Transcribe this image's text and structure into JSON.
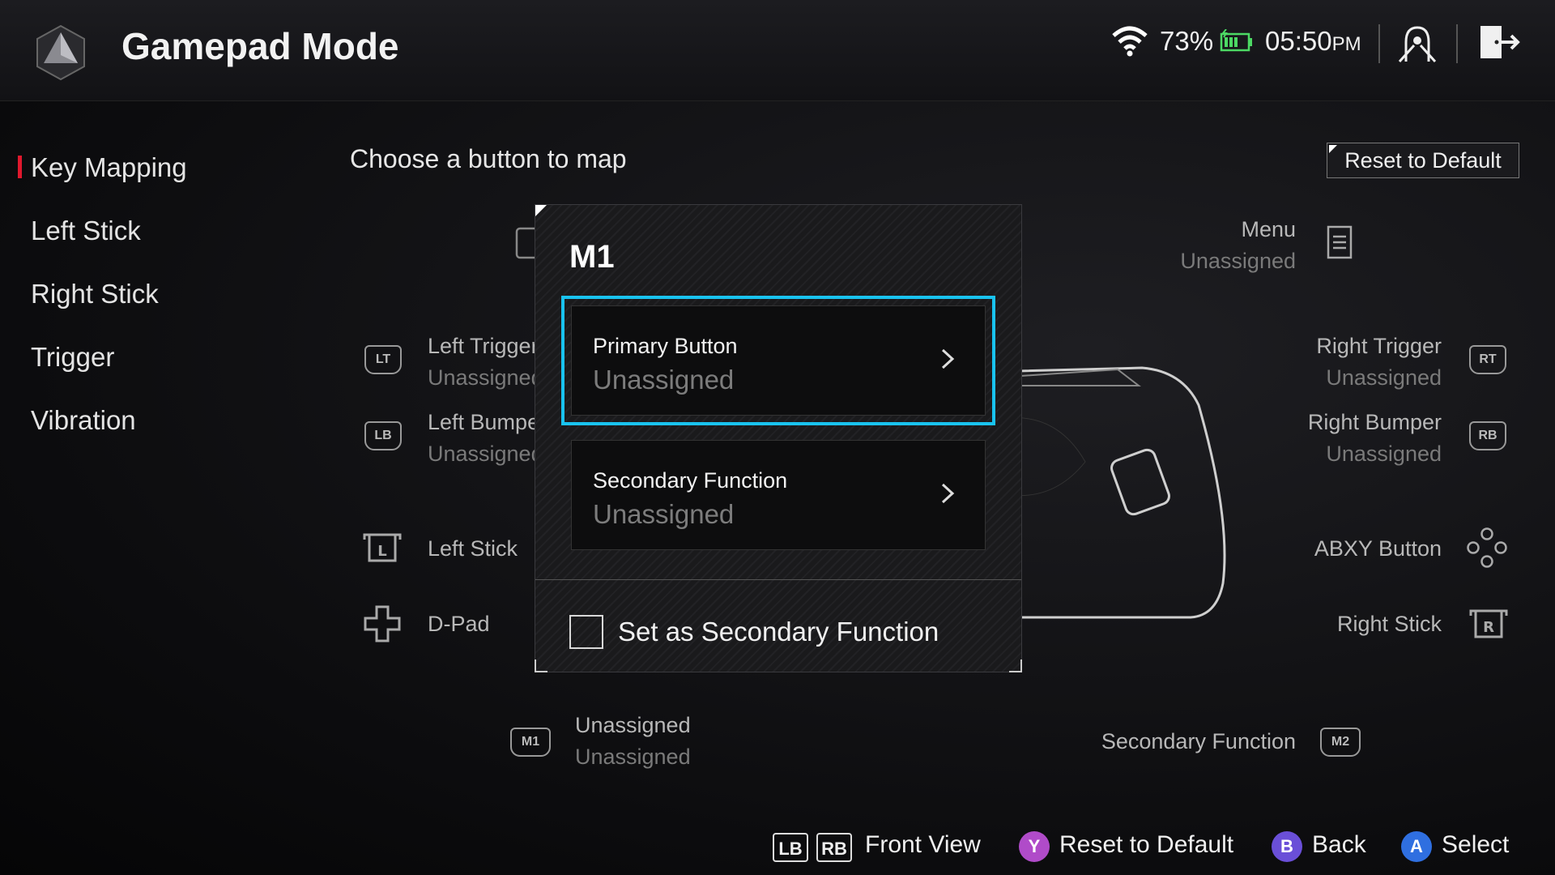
{
  "header": {
    "title": "Gamepad Mode",
    "battery_percent": "73%",
    "time": "05:50",
    "time_suffix": "PM",
    "accent_color": "#e0182d"
  },
  "sidebar": {
    "items": [
      {
        "label": "Key Mapping",
        "active": true
      },
      {
        "label": "Left Stick"
      },
      {
        "label": "Right Stick"
      },
      {
        "label": "Trigger"
      },
      {
        "label": "Vibration"
      }
    ]
  },
  "main": {
    "heading": "Choose a button to map",
    "reset_label": "Reset to Default",
    "menu": {
      "name": "Menu",
      "value": "Unassigned"
    },
    "left_trigger": {
      "badge": "LT",
      "name": "Left Trigger",
      "value": "Unassigned"
    },
    "left_bumper": {
      "badge": "LB",
      "name": "Left Bumper",
      "value": "Unassigned"
    },
    "left_stick": {
      "name": "Left Stick"
    },
    "dpad": {
      "name": "D-Pad"
    },
    "m1": {
      "badge": "M1",
      "name": "Unassigned",
      "value": "Unassigned"
    },
    "right_trigger": {
      "badge": "RT",
      "name": "Right Trigger",
      "value": "Unassigned"
    },
    "right_bumper": {
      "badge": "RB",
      "name": "Right Bumper",
      "value": "Unassigned"
    },
    "abxy": {
      "name": "ABXY Button"
    },
    "right_stick": {
      "name": "Right Stick"
    },
    "m2": {
      "badge": "M2",
      "name": "Secondary Function"
    }
  },
  "modal": {
    "title": "M1",
    "primary": {
      "label": "Primary Button",
      "value": "Unassigned"
    },
    "secondary": {
      "label": "Secondary Function",
      "value": "Unassigned"
    },
    "checkbox_label": "Set as Secondary Function",
    "checked": false,
    "selection_color": "#19c3f0"
  },
  "footer": {
    "lb": "LB",
    "rb": "RB",
    "front_view": "Front View",
    "y_key": "Y",
    "reset": "Reset to Default",
    "b_key": "B",
    "back": "Back",
    "a_key": "A",
    "select": "Select"
  }
}
